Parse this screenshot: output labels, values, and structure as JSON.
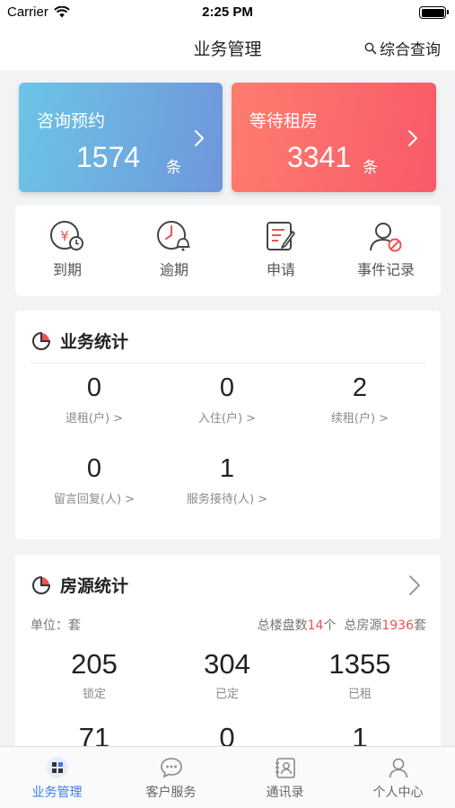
{
  "status_bar": {
    "carrier": "Carrier",
    "time": "2:25 PM"
  },
  "nav": {
    "title": "业务管理",
    "query_label": "综合查询"
  },
  "top_cards": [
    {
      "title": "咨询预约",
      "count": "1574",
      "unit": "条"
    },
    {
      "title": "等待租房",
      "count": "3341",
      "unit": "条"
    }
  ],
  "quick_actions": [
    {
      "label": "到期",
      "icon": "expire-icon"
    },
    {
      "label": "逾期",
      "icon": "overdue-icon"
    },
    {
      "label": "申请",
      "icon": "apply-icon"
    },
    {
      "label": "事件记录",
      "icon": "event-record-icon"
    }
  ],
  "business_stats": {
    "title": "业务统计",
    "items": [
      {
        "value": "0",
        "label": "退租(户) >"
      },
      {
        "value": "0",
        "label": "入住(户) >"
      },
      {
        "value": "2",
        "label": "续租(户) >"
      },
      {
        "value": "0",
        "label": "留言回复(人) >"
      },
      {
        "value": "1",
        "label": "服务接待(人) >"
      }
    ]
  },
  "house_stats": {
    "title": "房源统计",
    "unit_label": "单位：套",
    "total_buildings_prefix": "总楼盘数",
    "total_buildings": "14",
    "total_buildings_suffix": "个",
    "total_houses_prefix": "总房源",
    "total_houses": "1936",
    "total_houses_suffix": "套",
    "items": [
      {
        "value": "205",
        "label": "锁定"
      },
      {
        "value": "304",
        "label": "已定"
      },
      {
        "value": "1355",
        "label": "已租"
      },
      {
        "value": "71",
        "label": ""
      },
      {
        "value": "0",
        "label": ""
      },
      {
        "value": "1",
        "label": ""
      }
    ]
  },
  "tabs": [
    {
      "label": "业务管理",
      "active": true
    },
    {
      "label": "客户服务",
      "active": false
    },
    {
      "label": "通讯录",
      "active": false
    },
    {
      "label": "个人中心",
      "active": false
    }
  ],
  "colors": {
    "accent": "#3d7cf0",
    "highlight": "#f05050",
    "card_blue": "#6f96db",
    "card_red": "#f85a68"
  }
}
